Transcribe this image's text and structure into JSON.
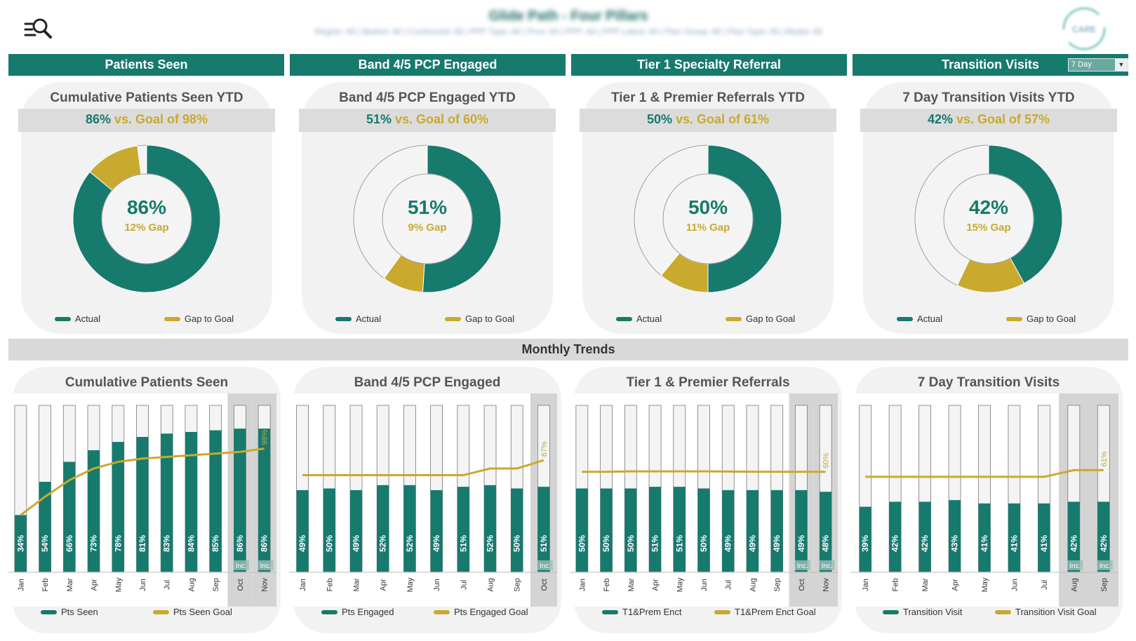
{
  "header": {
    "title": "Glide Path - Four Pillars",
    "filters": "Region: All | Market: All | Contracted: All | PPP Type: All | Prov: All | PPP: All | PPP Latest: All | Plan Group: All | Plan Type: All | Media: All",
    "logo_text": "CARE",
    "search_icon": "search-filter-icon"
  },
  "colors": {
    "teal": "#167a6d",
    "gold": "#c9a92e",
    "card": "#f2f2f2",
    "band": "#dcdcdc"
  },
  "sections": [
    {
      "label": "Patients Seen"
    },
    {
      "label": "Band 4/5 PCP Engaged"
    },
    {
      "label": "Tier 1 Specialty Referral"
    },
    {
      "label": "Transition Visits"
    }
  ],
  "dropdown": {
    "value": "7 Day",
    "icon": "chevron-down-icon"
  },
  "trends_title": "Monthly Trends",
  "chart_data": [
    {
      "type": "pie",
      "title": "Cumulative Patients Seen YTD",
      "actual_text": "86%",
      "goal_text": "vs. Goal of 98%",
      "center_value": "86%",
      "gap_text": "12% Gap",
      "actual": 86,
      "gap": 12,
      "legend": [
        "Actual",
        "Gap to Goal"
      ]
    },
    {
      "type": "pie",
      "title": "Band 4/5 PCP Engaged YTD",
      "actual_text": "51%",
      "goal_text": "vs. Goal of 60%",
      "center_value": "51%",
      "gap_text": "9% Gap",
      "actual": 51,
      "gap": 9,
      "legend": [
        "Actual",
        "Gap to Goal"
      ]
    },
    {
      "type": "pie",
      "title": "Tier 1 & Premier Referrals YTD",
      "actual_text": "50%",
      "goal_text": "vs. Goal of 61%",
      "center_value": "50%",
      "gap_text": "11% Gap",
      "actual": 50,
      "gap": 11,
      "legend": [
        "Actual",
        "Gap to Goal"
      ]
    },
    {
      "type": "pie",
      "title": "7 Day Transition Visits YTD",
      "actual_text": "42%",
      "goal_text": "vs. Goal of 57%",
      "center_value": "42%",
      "gap_text": "15% Gap",
      "actual": 42,
      "gap": 15,
      "legend": [
        "Actual",
        "Gap to Goal"
      ]
    },
    {
      "type": "bar",
      "title": "Cumulative Patients Seen",
      "categories": [
        "Jan",
        "Feb",
        "Mar",
        "Apr",
        "May",
        "Jun",
        "Jul",
        "Aug",
        "Sep",
        "Oct",
        "Nov"
      ],
      "values": [
        34,
        54,
        66,
        73,
        78,
        81,
        83,
        84,
        85,
        86,
        86
      ],
      "labels": [
        "34%",
        "54%",
        "66%",
        "73%",
        "78%",
        "81%",
        "83%",
        "84%",
        "85%",
        "86%",
        "86%"
      ],
      "goal": [
        34,
        45,
        55,
        62,
        66,
        68,
        69,
        70,
        71,
        72,
        74
      ],
      "goal_label": "98%",
      "incomplete": [
        9,
        10
      ],
      "inc_label": "Inc.",
      "ylim": [
        0,
        100
      ],
      "series": [
        {
          "name": "Pts Seen"
        },
        {
          "name": "Pts Seen Goal"
        }
      ]
    },
    {
      "type": "bar",
      "title": "Band 4/5 PCP Engaged",
      "categories": [
        "Jan",
        "Feb",
        "Mar",
        "Apr",
        "May",
        "Jun",
        "Jul",
        "Aug",
        "Sep",
        "Oct"
      ],
      "values": [
        49,
        50,
        49,
        52,
        52,
        49,
        51,
        52,
        50,
        51
      ],
      "labels": [
        "49%",
        "50%",
        "49%",
        "52%",
        "52%",
        "49%",
        "51%",
        "52%",
        "50%",
        "51%"
      ],
      "goal": [
        58,
        58,
        58,
        58,
        58,
        58,
        58,
        62,
        62,
        67
      ],
      "goal_label": "67%",
      "incomplete": [
        9
      ],
      "inc_label": "Inc.",
      "ylim": [
        0,
        100
      ],
      "series": [
        {
          "name": "Pts Engaged"
        },
        {
          "name": "Pts Engaged Goal"
        }
      ]
    },
    {
      "type": "bar",
      "title": "Tier 1 & Premier Referrals",
      "categories": [
        "Jan",
        "Feb",
        "Mar",
        "Apr",
        "May",
        "Jun",
        "Jul",
        "Aug",
        "Sep",
        "Oct",
        "Nov"
      ],
      "values": [
        50,
        50,
        50,
        51,
        51,
        50,
        49,
        49,
        49,
        49,
        48
      ],
      "labels": [
        "50%",
        "50%",
        "50%",
        "51%",
        "51%",
        "50%",
        "49%",
        "49%",
        "49%",
        "49%",
        "48%"
      ],
      "goal": [
        60,
        60,
        60.3,
        60.3,
        60.3,
        60.3,
        60.2,
        60.1,
        60,
        60,
        60
      ],
      "goal_label": "60%",
      "incomplete": [
        9,
        10
      ],
      "inc_label": "Inc.",
      "ylim": [
        0,
        100
      ],
      "series": [
        {
          "name": "T1&Prem Enct"
        },
        {
          "name": "T1&Prem Enct Goal"
        }
      ]
    },
    {
      "type": "bar",
      "title": "7 Day Transition Visits",
      "categories": [
        "Jan",
        "Feb",
        "Mar",
        "Apr",
        "May",
        "Jun",
        "Jul",
        "Aug",
        "Sep"
      ],
      "values": [
        39,
        42,
        42,
        43,
        41,
        41,
        41,
        42,
        42
      ],
      "labels": [
        "39%",
        "42%",
        "42%",
        "43%",
        "41%",
        "41%",
        "41%",
        "42%",
        "42%"
      ],
      "goal": [
        57,
        57,
        57,
        57,
        57,
        57,
        57,
        61,
        61
      ],
      "goal_label": "61%",
      "incomplete": [
        7,
        8
      ],
      "inc_label": "Inc.",
      "ylim": [
        0,
        100
      ],
      "series": [
        {
          "name": "Transition Visit"
        },
        {
          "name": "Transition Visit Goal"
        }
      ]
    }
  ]
}
